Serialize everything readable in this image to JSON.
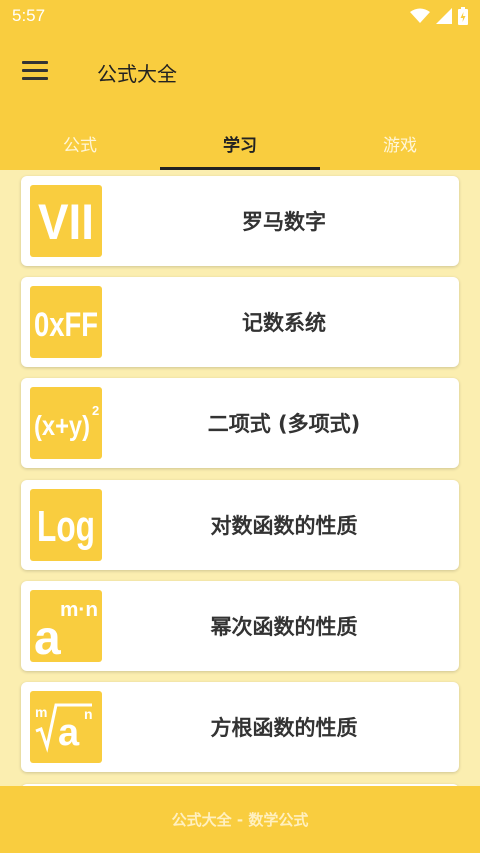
{
  "status_bar": {
    "time": "5:57",
    "icons": [
      "wifi-icon",
      "signal-icon",
      "battery-icon"
    ]
  },
  "app_bar": {
    "menu_icon": "menu-icon",
    "title": "公式大全"
  },
  "tabs": [
    {
      "label": "公式",
      "active": false
    },
    {
      "label": "学习",
      "active": true
    },
    {
      "label": "游戏",
      "active": false
    }
  ],
  "cards": [
    {
      "icon": "roman-numeral-icon",
      "icon_text": "VII",
      "title": "罗马数字"
    },
    {
      "icon": "hex-icon",
      "icon_text": "0xFF",
      "title": "记数系统"
    },
    {
      "icon": "binomial-icon",
      "icon_text": "(x+y)",
      "icon_sup": "2",
      "title": "二项式 (多项式)"
    },
    {
      "icon": "log-icon",
      "icon_text": "Log",
      "title": "对数函数的性质"
    },
    {
      "icon": "power-icon",
      "icon_text": "a",
      "icon_sup": "m·n",
      "title": "幂次函数的性质"
    },
    {
      "icon": "root-icon",
      "icon_text": "a",
      "icon_sup": "n",
      "icon_pre": "m",
      "title": "方根函数的性质"
    }
  ],
  "footer": {
    "text": "公式大全 - 数学公式"
  },
  "colors": {
    "primary": "#f9cd3f",
    "background": "#fbeeb0",
    "card": "#ffffff",
    "text_dark": "#333333"
  }
}
